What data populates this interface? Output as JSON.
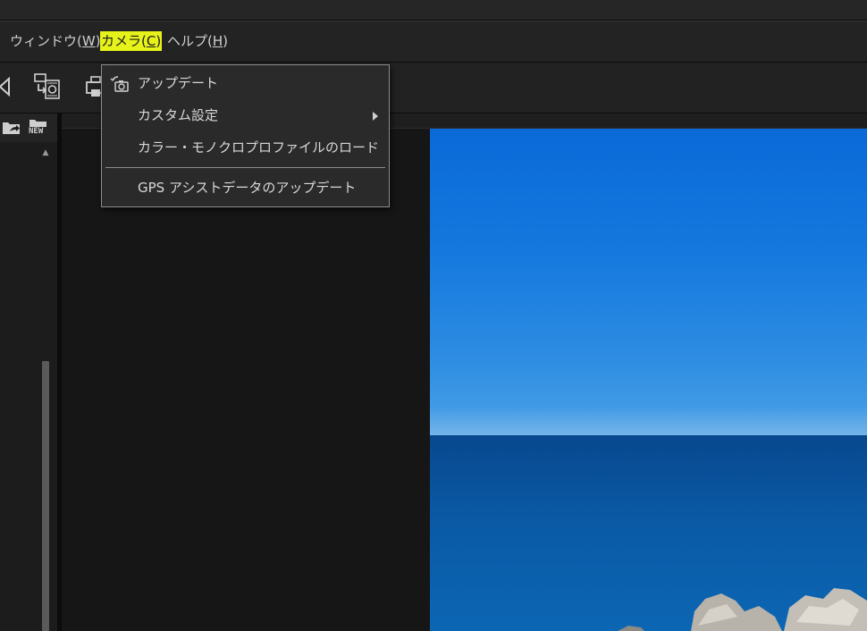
{
  "menubar": {
    "items": [
      {
        "label": "ウィンドウ(",
        "accel": "W",
        "close": ")"
      },
      {
        "label": "カメラ(",
        "accel": "C",
        "close": ")"
      },
      {
        "label": "ヘルプ(",
        "accel": "H",
        "close": ")"
      }
    ],
    "active_index": 1,
    "highlight_color": "#e6f21a"
  },
  "left_panel": {
    "header_icons": [
      "folder-arrow-icon",
      "new-folder-icon"
    ],
    "new_badge": "NEW"
  },
  "toolbar": {
    "icons": [
      "rotate-icon",
      "import-icon",
      "print-icon"
    ]
  },
  "camera_menu": {
    "items": [
      {
        "label": "アップデート",
        "icon": "camera-update-icon",
        "submenu": false
      },
      {
        "label": "カスタム設定",
        "submenu": true
      },
      {
        "label": "カラー・モノクロプロファイルのロード",
        "submenu": false
      },
      {
        "label": "GPS アシストデータのアップデート",
        "submenu": false
      }
    ]
  },
  "colors": {
    "menu_bg": "#2a2a2a",
    "app_bg": "#171717",
    "sky": "#1478de",
    "sea": "#0a5aa6"
  }
}
